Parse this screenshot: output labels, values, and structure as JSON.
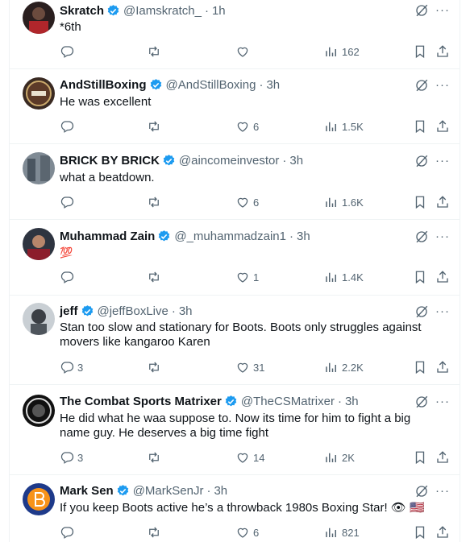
{
  "tweets": [
    {
      "name": "Skratch",
      "handle": "@Iamskratch_",
      "sep": "·",
      "time": "1h",
      "text": "*6th",
      "replies": "",
      "likes": "",
      "views": "162"
    },
    {
      "name": "AndStillBoxing",
      "handle": "@AndStillBoxing",
      "sep": "·",
      "time": "3h",
      "text": "He was excellent",
      "replies": "",
      "likes": "6",
      "views": "1.5K"
    },
    {
      "name": "BRICK BY BRICK",
      "handle": "@aincomeinvestor",
      "sep": "·",
      "time": "3h",
      "text": "what a beatdown.",
      "replies": "",
      "likes": "6",
      "views": "1.6K"
    },
    {
      "name": "Muhammad Zain",
      "handle": "@_muhammadzain1",
      "sep": "·",
      "time": "3h",
      "text": "",
      "emoji": "💯",
      "replies": "",
      "likes": "1",
      "views": "1.4K"
    },
    {
      "name": "jeff",
      "handle": "@jeffBoxLive",
      "sep": "·",
      "time": "3h",
      "text": "Stan too slow and stationary for Boots. Boots only struggles against movers like kangaroo Karen",
      "replies": "3",
      "likes": "31",
      "views": "2.2K"
    },
    {
      "name": "The Combat Sports Matrixer",
      "handle": "@TheCSMatrixer",
      "sep": "·",
      "time": "3h",
      "text": "He did what he waa suppose to. Now its time for him to fight a big name guy. He deserves a big time fight",
      "replies": "3",
      "likes": "14",
      "views": "2K"
    },
    {
      "name": "Mark Sen",
      "handle": "@MarkSenJr",
      "sep": "·",
      "time": "3h",
      "text": "If you keep Boots active he’s a throwback 1980s Boxing Star! 👁 🇺🇸",
      "replies": "",
      "likes": "6",
      "views": "821"
    }
  ],
  "icons": {
    "more": "···",
    "verified_color": "#1d9bf0",
    "action_color": "#536471"
  }
}
